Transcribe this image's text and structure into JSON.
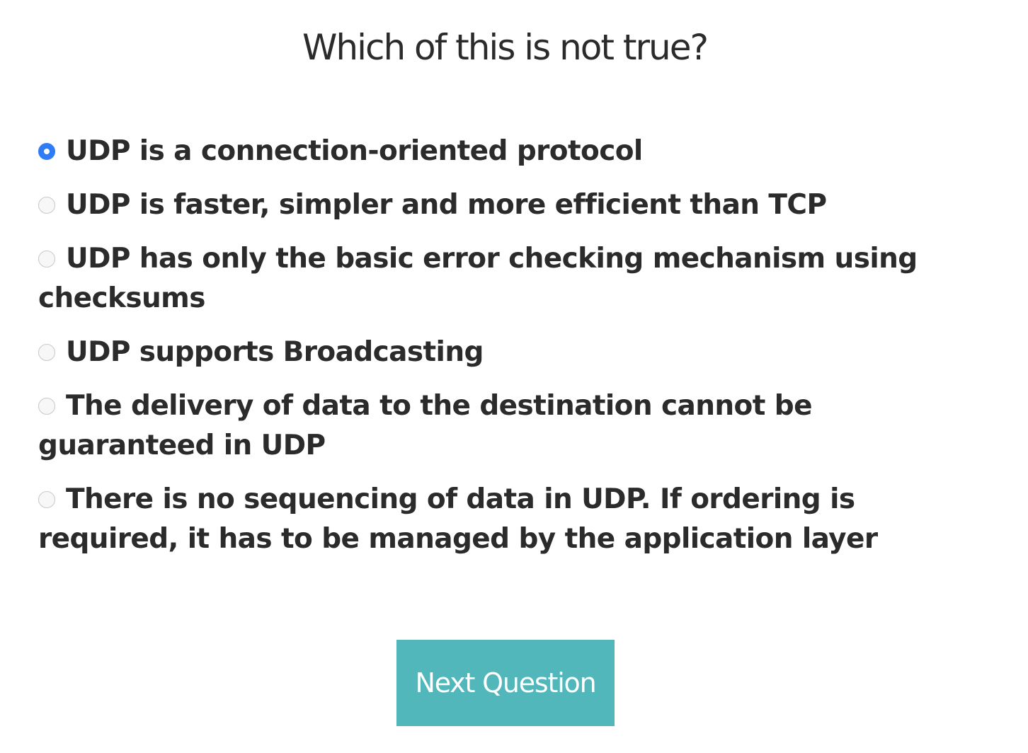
{
  "quiz": {
    "question": "Which of this is not true?",
    "selected_index": 0,
    "options": [
      {
        "label": "UDP is a connection-oriented protocol",
        "selected": true
      },
      {
        "label": "UDP is faster, simpler and more efficient than TCP",
        "selected": false
      },
      {
        "label": "UDP has only the basic error checking mechanism using checksums",
        "selected": false
      },
      {
        "label": "UDP supports Broadcasting",
        "selected": false
      },
      {
        "label": "The delivery of data to the destination cannot be guaranteed in UDP",
        "selected": false
      },
      {
        "label": "There is no sequencing of data in UDP. If ordering is required, it has to be managed by the application layer",
        "selected": false
      }
    ],
    "next_button_label": "Next Question"
  },
  "colors": {
    "accent_radio": "#2f7cf6",
    "button_background": "#52b7ba",
    "text": "#2b2b2b"
  }
}
